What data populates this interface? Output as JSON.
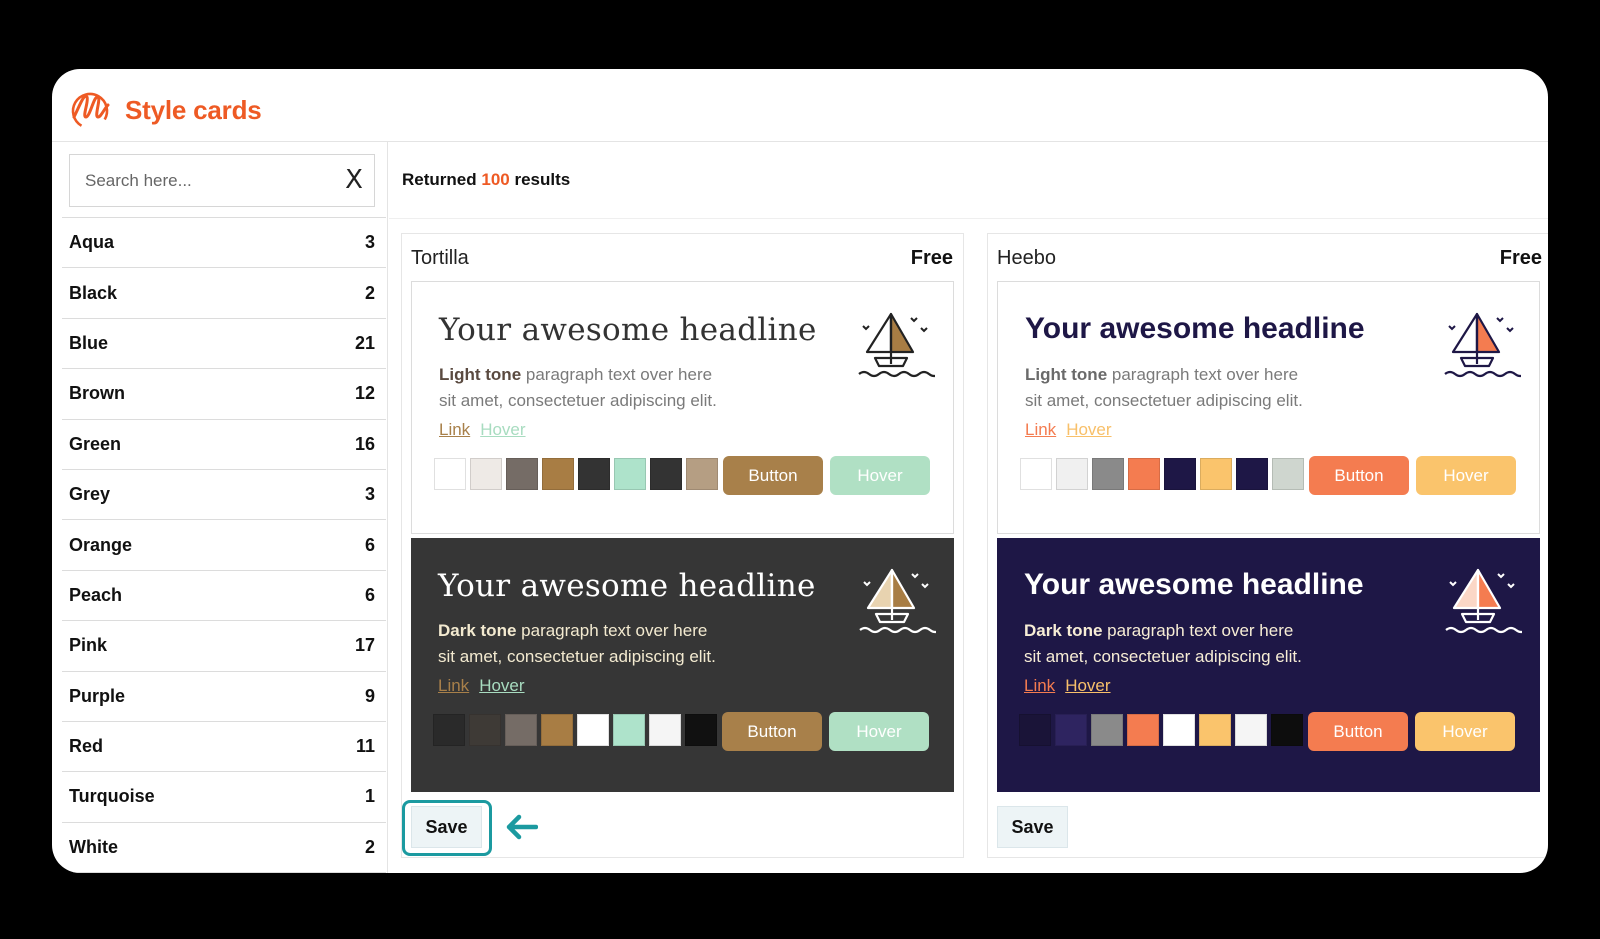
{
  "app": {
    "title": "Style cards",
    "logo_icon": "brand-logo-icon"
  },
  "search": {
    "placeholder": "Search here...",
    "clear_label": "X"
  },
  "filters": [
    {
      "label": "Aqua",
      "count": "3"
    },
    {
      "label": "Black",
      "count": "2"
    },
    {
      "label": "Blue",
      "count": "21"
    },
    {
      "label": "Brown",
      "count": "12"
    },
    {
      "label": "Green",
      "count": "16"
    },
    {
      "label": "Grey",
      "count": "3"
    },
    {
      "label": "Orange",
      "count": "6"
    },
    {
      "label": "Peach",
      "count": "6"
    },
    {
      "label": "Pink",
      "count": "17"
    },
    {
      "label": "Purple",
      "count": "9"
    },
    {
      "label": "Red",
      "count": "11"
    },
    {
      "label": "Turquoise",
      "count": "1"
    },
    {
      "label": "White",
      "count": "2"
    }
  ],
  "results": {
    "prefix": "Returned",
    "count": "100",
    "suffix": "results"
  },
  "cards": [
    {
      "name": "Tortilla",
      "price": "Free",
      "save_label": "Save",
      "light": {
        "headline": "Your awesome headline",
        "tone_label": "Light tone",
        "para_1": "paragraph text over here",
        "para_2": "sit amet, consectetuer adipiscing elit.",
        "link": "Link",
        "hover_link": "Hover",
        "button": "Button",
        "hover_button": "Hover",
        "bg": "#ffffff",
        "headline_color": "#333333",
        "text_color": "#7a7a7a",
        "bold_color": "#5a4a40",
        "link_color": "#a8804a",
        "hover_color": "#a8dcc0",
        "btn_color": "#a8804a",
        "btn_hover_color": "#b0e0c4",
        "swatches": [
          "#ffffff",
          "#eeeae6",
          "#756c66",
          "#a87d44",
          "#333333",
          "#aee3cb",
          "#333333",
          "#b59e83"
        ]
      },
      "dark": {
        "headline": "Your awesome headline",
        "tone_label": "Dark tone",
        "para_1": "paragraph text over here",
        "para_2": "sit amet, consectetuer adipiscing elit.",
        "link": "Link",
        "hover_link": "Hover",
        "button": "Button",
        "hover_button": "Hover",
        "bg": "#363636",
        "headline_color": "#ffffff",
        "text_color": "#f3ead0",
        "bold_color": "#f3ead0",
        "link_color": "#a8804a",
        "hover_color": "#a8dcc0",
        "btn_color": "#a8804a",
        "btn_hover_color": "#b0e0c4",
        "swatches": [
          "#2a2a2a",
          "#3e3a36",
          "#756c66",
          "#a87d44",
          "#ffffff",
          "#aee3cb",
          "#f5f5f5",
          "#111111"
        ]
      },
      "boat_sail": "#a87d44"
    },
    {
      "name": "Heebo",
      "price": "Free",
      "save_label": "Save",
      "light": {
        "headline": "Your awesome headline",
        "tone_label": "Light tone",
        "para_1": "paragraph text over here",
        "para_2": "sit amet, consectetuer adipiscing elit.",
        "link": "Link",
        "hover_link": "Hover",
        "button": "Button",
        "hover_button": "Hover",
        "bg": "#ffffff",
        "headline_color": "#1e1746",
        "text_color": "#7a7a7a",
        "bold_color": "#6a6a6a",
        "link_color": "#f47c50",
        "hover_color": "#f8c06a",
        "btn_color": "#f47c50",
        "btn_hover_color": "#fac46c",
        "swatches": [
          "#ffffff",
          "#f0f0f0",
          "#8a8a8a",
          "#f47c50",
          "#1e1746",
          "#fac46c",
          "#1e1746",
          "#cfd6cf"
        ]
      },
      "dark": {
        "headline": "Your awesome headline",
        "tone_label": "Dark tone",
        "para_1": "paragraph text over here",
        "para_2": "sit amet, consectetuer adipiscing elit.",
        "link": "Link",
        "hover_link": "Hover",
        "button": "Button",
        "hover_button": "Hover",
        "bg": "#1e1746",
        "headline_color": "#ffffff",
        "text_color": "#f7edd5",
        "bold_color": "#f7edd5",
        "link_color": "#f47c50",
        "hover_color": "#f8c06a",
        "btn_color": "#f47c50",
        "btn_hover_color": "#fac46c",
        "swatches": [
          "#1a1438",
          "#2e2460",
          "#8a8a8a",
          "#f47c50",
          "#ffffff",
          "#fac46c",
          "#f5f5f5",
          "#0d0d0d"
        ]
      },
      "boat_sail": "#f47c50"
    }
  ],
  "colors": {
    "brand": "#ee5a24",
    "highlight": "#1b9aa0"
  }
}
